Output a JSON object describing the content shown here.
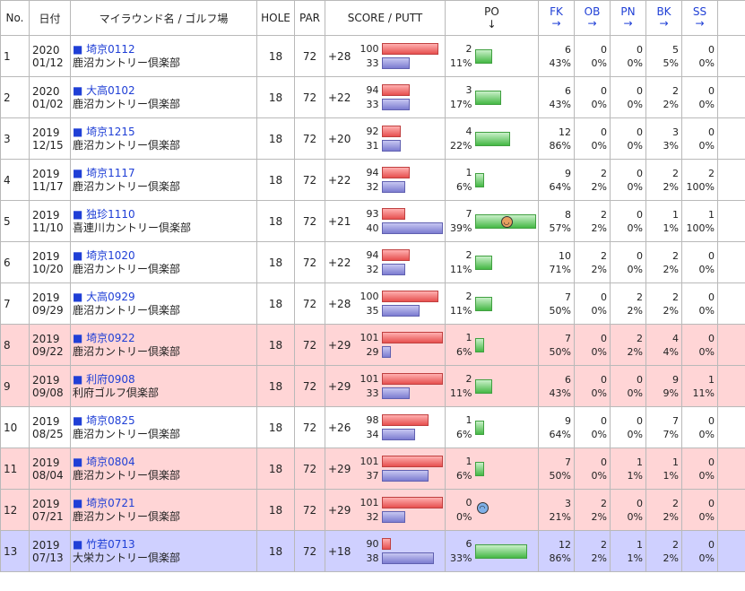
{
  "headers": {
    "no": "No.",
    "date": "日付",
    "round": "マイラウンド名 / ゴルフ場",
    "hole": "HOLE",
    "par": "PAR",
    "score": "SCORE / PUTT",
    "po": "PO",
    "po_arrow": "↓",
    "fk": "FK",
    "ob": "OB",
    "pn": "PN",
    "bk": "BK",
    "ss": "SS",
    "arrow": "→"
  },
  "rows": [
    {
      "no": "1",
      "year": "2020",
      "md": "01/12",
      "name": "■ 埼京0112",
      "course": "鹿沼カントリー倶楽部",
      "hole": "18",
      "par": "72",
      "diff": "+28",
      "score": "100",
      "putt": "33",
      "po": "2",
      "po_pct": "11%",
      "face": "",
      "fk": "6",
      "fk_pct": "43%",
      "ob": "0",
      "ob_pct": "0%",
      "pn": "0",
      "pn_pct": "0%",
      "bk": "5",
      "bk_pct": "5%",
      "ss": "0",
      "ss_pct": "0%",
      "style": "white"
    },
    {
      "no": "2",
      "year": "2020",
      "md": "01/02",
      "name": "■ 大高0102",
      "course": "鹿沼カントリー倶楽部",
      "hole": "18",
      "par": "72",
      "diff": "+22",
      "score": "94",
      "putt": "33",
      "po": "3",
      "po_pct": "17%",
      "face": "",
      "fk": "6",
      "fk_pct": "43%",
      "ob": "0",
      "ob_pct": "0%",
      "pn": "0",
      "pn_pct": "0%",
      "bk": "2",
      "bk_pct": "2%",
      "ss": "0",
      "ss_pct": "0%",
      "style": "white"
    },
    {
      "no": "3",
      "year": "2019",
      "md": "12/15",
      "name": "■ 埼京1215",
      "course": "鹿沼カントリー倶楽部",
      "hole": "18",
      "par": "72",
      "diff": "+20",
      "score": "92",
      "putt": "31",
      "po": "4",
      "po_pct": "22%",
      "face": "",
      "fk": "12",
      "fk_pct": "86%",
      "ob": "0",
      "ob_pct": "0%",
      "pn": "0",
      "pn_pct": "0%",
      "bk": "3",
      "bk_pct": "3%",
      "ss": "0",
      "ss_pct": "0%",
      "style": "white"
    },
    {
      "no": "4",
      "year": "2019",
      "md": "11/17",
      "name": "■ 埼京1117",
      "course": "鹿沼カントリー倶楽部",
      "hole": "18",
      "par": "72",
      "diff": "+22",
      "score": "94",
      "putt": "32",
      "po": "1",
      "po_pct": "6%",
      "face": "",
      "fk": "9",
      "fk_pct": "64%",
      "ob": "2",
      "ob_pct": "2%",
      "pn": "0",
      "pn_pct": "0%",
      "bk": "2",
      "bk_pct": "2%",
      "ss": "2",
      "ss_pct": "100%",
      "style": "white"
    },
    {
      "no": "5",
      "year": "2019",
      "md": "11/10",
      "name": "■ 独珍1110",
      "course": "喜連川カントリー倶楽部",
      "hole": "18",
      "par": "72",
      "diff": "+21",
      "score": "93",
      "putt": "40",
      "po": "7",
      "po_pct": "39%",
      "face": "good",
      "fk": "8",
      "fk_pct": "57%",
      "ob": "2",
      "ob_pct": "2%",
      "pn": "0",
      "pn_pct": "0%",
      "bk": "1",
      "bk_pct": "1%",
      "ss": "1",
      "ss_pct": "100%",
      "style": "white"
    },
    {
      "no": "6",
      "year": "2019",
      "md": "10/20",
      "name": "■ 埼京1020",
      "course": "鹿沼カントリー倶楽部",
      "hole": "18",
      "par": "72",
      "diff": "+22",
      "score": "94",
      "putt": "32",
      "po": "2",
      "po_pct": "11%",
      "face": "",
      "fk": "10",
      "fk_pct": "71%",
      "ob": "2",
      "ob_pct": "2%",
      "pn": "0",
      "pn_pct": "0%",
      "bk": "2",
      "bk_pct": "2%",
      "ss": "0",
      "ss_pct": "0%",
      "style": "white"
    },
    {
      "no": "7",
      "year": "2019",
      "md": "09/29",
      "name": "■ 大高0929",
      "course": "鹿沼カントリー倶楽部",
      "hole": "18",
      "par": "72",
      "diff": "+28",
      "score": "100",
      "putt": "35",
      "po": "2",
      "po_pct": "11%",
      "face": "",
      "fk": "7",
      "fk_pct": "50%",
      "ob": "0",
      "ob_pct": "0%",
      "pn": "2",
      "pn_pct": "2%",
      "bk": "2",
      "bk_pct": "2%",
      "ss": "0",
      "ss_pct": "0%",
      "style": "white"
    },
    {
      "no": "8",
      "year": "2019",
      "md": "09/22",
      "name": "■ 埼京0922",
      "course": "鹿沼カントリー倶楽部",
      "hole": "18",
      "par": "72",
      "diff": "+29",
      "score": "101",
      "putt": "29",
      "po": "1",
      "po_pct": "6%",
      "face": "",
      "fk": "7",
      "fk_pct": "50%",
      "ob": "0",
      "ob_pct": "0%",
      "pn": "2",
      "pn_pct": "2%",
      "bk": "4",
      "bk_pct": "4%",
      "ss": "0",
      "ss_pct": "0%",
      "style": "pink"
    },
    {
      "no": "9",
      "year": "2019",
      "md": "09/08",
      "name": "■ 利府0908",
      "course": "利府ゴルフ倶楽部",
      "hole": "18",
      "par": "72",
      "diff": "+29",
      "score": "101",
      "putt": "33",
      "po": "2",
      "po_pct": "11%",
      "face": "",
      "fk": "6",
      "fk_pct": "43%",
      "ob": "0",
      "ob_pct": "0%",
      "pn": "0",
      "pn_pct": "0%",
      "bk": "9",
      "bk_pct": "9%",
      "ss": "1",
      "ss_pct": "11%",
      "style": "pink"
    },
    {
      "no": "10",
      "year": "2019",
      "md": "08/25",
      "name": "■ 埼京0825",
      "course": "鹿沼カントリー倶楽部",
      "hole": "18",
      "par": "72",
      "diff": "+26",
      "score": "98",
      "putt": "34",
      "po": "1",
      "po_pct": "6%",
      "face": "",
      "fk": "9",
      "fk_pct": "64%",
      "ob": "0",
      "ob_pct": "0%",
      "pn": "0",
      "pn_pct": "0%",
      "bk": "7",
      "bk_pct": "7%",
      "ss": "0",
      "ss_pct": "0%",
      "style": "white"
    },
    {
      "no": "11",
      "year": "2019",
      "md": "08/04",
      "name": "■ 埼京0804",
      "course": "鹿沼カントリー倶楽部",
      "hole": "18",
      "par": "72",
      "diff": "+29",
      "score": "101",
      "putt": "37",
      "po": "1",
      "po_pct": "6%",
      "face": "",
      "fk": "7",
      "fk_pct": "50%",
      "ob": "0",
      "ob_pct": "0%",
      "pn": "1",
      "pn_pct": "1%",
      "bk": "1",
      "bk_pct": "1%",
      "ss": "0",
      "ss_pct": "0%",
      "style": "pink"
    },
    {
      "no": "12",
      "year": "2019",
      "md": "07/21",
      "name": "■ 埼京0721",
      "course": "鹿沼カントリー倶楽部",
      "hole": "18",
      "par": "72",
      "diff": "+29",
      "score": "101",
      "putt": "32",
      "po": "0",
      "po_pct": "0%",
      "face": "bad",
      "fk": "3",
      "fk_pct": "21%",
      "ob": "2",
      "ob_pct": "2%",
      "pn": "0",
      "pn_pct": "0%",
      "bk": "2",
      "bk_pct": "2%",
      "ss": "0",
      "ss_pct": "0%",
      "style": "pink"
    },
    {
      "no": "13",
      "year": "2019",
      "md": "07/13",
      "name": "■ 竹若0713",
      "course": "大栄カントリー倶楽部",
      "hole": "18",
      "par": "72",
      "diff": "+18",
      "score": "90",
      "putt": "38",
      "po": "6",
      "po_pct": "33%",
      "face": "",
      "fk": "12",
      "fk_pct": "86%",
      "ob": "2",
      "ob_pct": "2%",
      "pn": "1",
      "pn_pct": "1%",
      "bk": "2",
      "bk_pct": "2%",
      "ss": "0",
      "ss_pct": "0%",
      "style": "lav"
    }
  ]
}
